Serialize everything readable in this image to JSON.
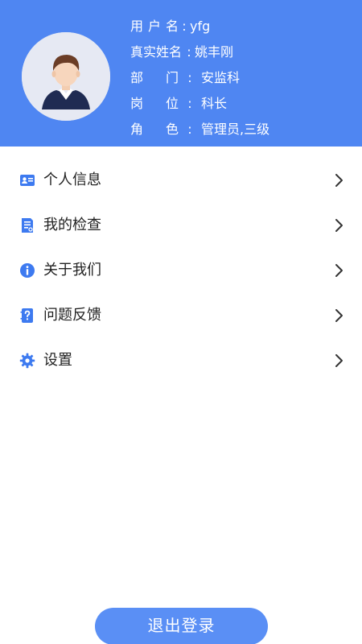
{
  "profile": {
    "username_label": "用户名",
    "username": "yfg",
    "realname_label": "真实姓名",
    "realname": "姚丰刚",
    "dept_label": "部门",
    "dept": "安监科",
    "post_label": "岗位",
    "post": "科长",
    "role_label": "角色",
    "role": "管理员,三级",
    "separator": ":"
  },
  "menu": {
    "items": [
      {
        "label": "个人信息",
        "icon": "id-card-icon"
      },
      {
        "label": "我的检查",
        "icon": "document-check-icon"
      },
      {
        "label": "关于我们",
        "icon": "info-icon"
      },
      {
        "label": "问题反馈",
        "icon": "feedback-question-icon"
      },
      {
        "label": "设置",
        "icon": "gear-icon"
      }
    ]
  },
  "logout_label": "退出登录",
  "colors": {
    "header_bg": "#4f86f2",
    "accent_icon": "#3d7af0",
    "button_bg": "#5a8ff5"
  }
}
